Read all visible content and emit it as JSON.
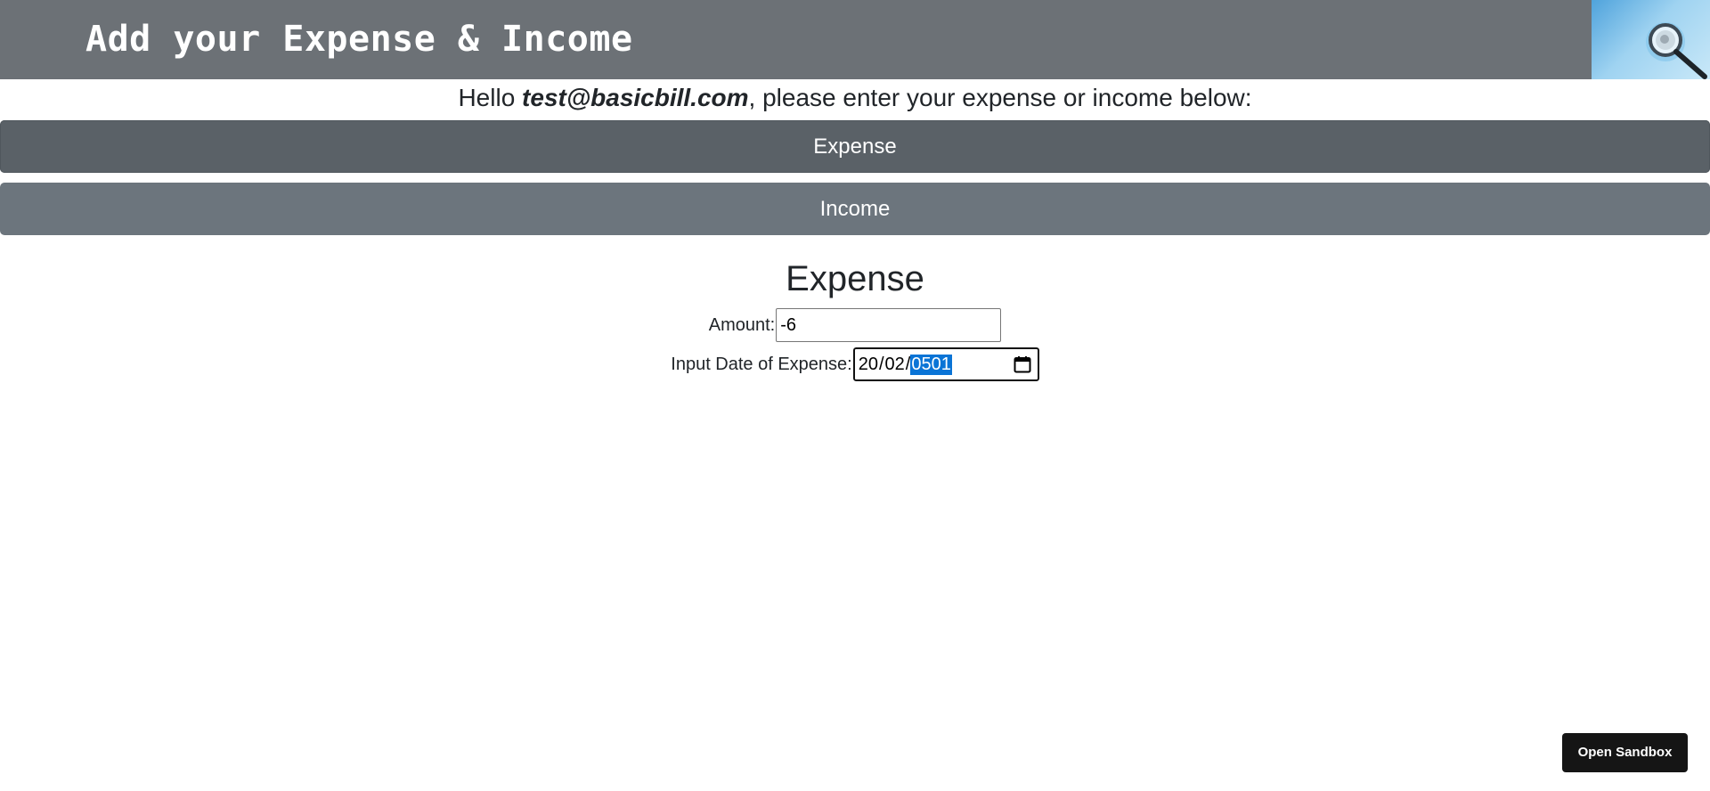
{
  "header": {
    "title": "Add your Expense & Income",
    "logo_icon": "magnifier-logo-icon"
  },
  "greeting": {
    "prefix": "Hello ",
    "email": "test@basicbill.com",
    "suffix": ", please enter your expense or income below:"
  },
  "tabs": {
    "expense_label": "Expense",
    "income_label": "Income"
  },
  "form": {
    "title": "Expense",
    "amount_label": "Amount:",
    "amount_value": "-6",
    "date_label": "Input Date of Expense:",
    "date_day": "20",
    "date_month": "02",
    "date_year": "0501",
    "date_separator": "/",
    "calendar_icon": "calendar-icon"
  },
  "sandbox": {
    "label": "Open Sandbox"
  },
  "colors": {
    "header_bg": "#6c7176",
    "expense_tab_bg": "#5a6167",
    "income_tab_bg": "#6c757d",
    "selection": "#0a74d6",
    "sandbox_bg": "#151515"
  }
}
